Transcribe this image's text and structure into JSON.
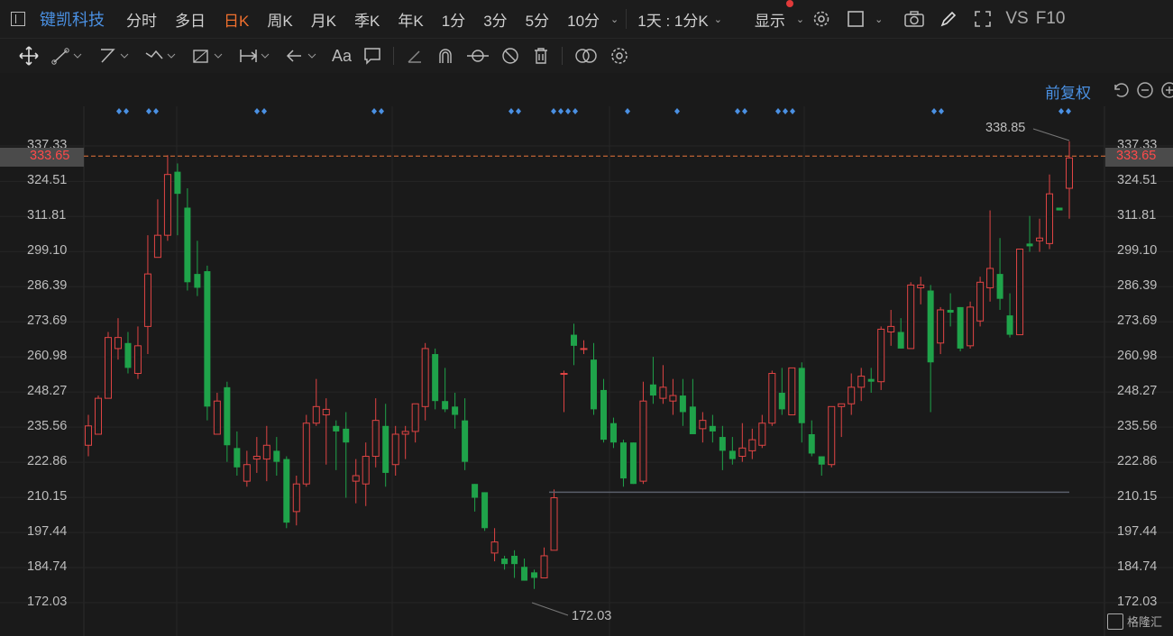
{
  "topbar": {
    "symbol": "键凯科技",
    "periods": [
      "分时",
      "多日",
      "日K",
      "周K",
      "月K",
      "季K",
      "年K",
      "1分",
      "3分",
      "5分",
      "10分"
    ],
    "active_period": "日K",
    "interval_select": "1天 : 1分K",
    "display_label": "显示",
    "vs_label": "VS",
    "f10_label": "F10"
  },
  "chart": {
    "adjust_label": "前复权",
    "current_price": "333.65",
    "high_label": "338.85",
    "low_label": "172.03",
    "y_ticks": [
      "337.33",
      "324.51",
      "311.81",
      "299.10",
      "286.39",
      "273.69",
      "260.98",
      "248.27",
      "235.56",
      "222.86",
      "210.15",
      "197.44",
      "184.74",
      "172.03"
    ],
    "watermark": "格隆汇",
    "up_color": "#e04444",
    "down_color": "#1fa34a",
    "marker_color": "#4a90e2",
    "ref_line_color": "#e8743b"
  },
  "chart_data": {
    "type": "candlestick",
    "ylim": [
      172.03,
      337.33
    ],
    "candles": [
      {
        "o": 229,
        "h": 240,
        "l": 225,
        "c": 236
      },
      {
        "o": 233,
        "h": 247,
        "l": 233,
        "c": 246
      },
      {
        "o": 246,
        "h": 270,
        "l": 246,
        "c": 268
      },
      {
        "o": 264,
        "h": 275,
        "l": 260,
        "c": 268
      },
      {
        "o": 266,
        "h": 270,
        "l": 255,
        "c": 257
      },
      {
        "o": 255,
        "h": 272,
        "l": 253,
        "c": 265
      },
      {
        "o": 272,
        "h": 305,
        "l": 262,
        "c": 291
      },
      {
        "o": 297,
        "h": 318,
        "l": 297,
        "c": 305
      },
      {
        "o": 305,
        "h": 334,
        "l": 303,
        "c": 327
      },
      {
        "o": 328,
        "h": 331,
        "l": 305,
        "c": 320
      },
      {
        "o": 315,
        "h": 322,
        "l": 285,
        "c": 288
      },
      {
        "o": 291,
        "h": 303,
        "l": 283,
        "c": 286
      },
      {
        "o": 292,
        "h": 294,
        "l": 238,
        "c": 243
      },
      {
        "o": 233,
        "h": 248,
        "l": 233,
        "c": 245
      },
      {
        "o": 250,
        "h": 252,
        "l": 223,
        "c": 229
      },
      {
        "o": 228,
        "h": 234,
        "l": 218,
        "c": 221
      },
      {
        "o": 216,
        "h": 227,
        "l": 214,
        "c": 222
      },
      {
        "o": 224,
        "h": 232,
        "l": 219,
        "c": 225
      },
      {
        "o": 224,
        "h": 236,
        "l": 216,
        "c": 229
      },
      {
        "o": 227,
        "h": 232,
        "l": 218,
        "c": 223
      },
      {
        "o": 224,
        "h": 225,
        "l": 199,
        "c": 201
      },
      {
        "o": 205,
        "h": 218,
        "l": 200,
        "c": 215
      },
      {
        "o": 215,
        "h": 240,
        "l": 214,
        "c": 237
      },
      {
        "o": 237,
        "h": 253,
        "l": 236,
        "c": 243
      },
      {
        "o": 240,
        "h": 246,
        "l": 222,
        "c": 242
      },
      {
        "o": 236,
        "h": 238,
        "l": 220,
        "c": 234
      },
      {
        "o": 235,
        "h": 241,
        "l": 210,
        "c": 230
      },
      {
        "o": 216,
        "h": 224,
        "l": 208,
        "c": 218
      },
      {
        "o": 215,
        "h": 230,
        "l": 207,
        "c": 225
      },
      {
        "o": 225,
        "h": 246,
        "l": 221,
        "c": 238
      },
      {
        "o": 236,
        "h": 244,
        "l": 214,
        "c": 219
      },
      {
        "o": 222,
        "h": 236,
        "l": 218,
        "c": 233
      },
      {
        "o": 233,
        "h": 236,
        "l": 224,
        "c": 234
      },
      {
        "o": 234,
        "h": 244,
        "l": 230,
        "c": 244
      },
      {
        "o": 243,
        "h": 266,
        "l": 238,
        "c": 264
      },
      {
        "o": 262,
        "h": 264,
        "l": 242,
        "c": 245
      },
      {
        "o": 245,
        "h": 257,
        "l": 241,
        "c": 242
      },
      {
        "o": 243,
        "h": 248,
        "l": 235,
        "c": 240
      },
      {
        "o": 238,
        "h": 246,
        "l": 220,
        "c": 223
      },
      {
        "o": 215,
        "h": 213,
        "l": 205,
        "c": 210
      },
      {
        "o": 212,
        "h": 211,
        "l": 198,
        "c": 199
      },
      {
        "o": 190,
        "h": 199,
        "l": 187,
        "c": 194
      },
      {
        "o": 188,
        "h": 189,
        "l": 184,
        "c": 186
      },
      {
        "o": 189,
        "h": 191,
        "l": 181,
        "c": 186
      },
      {
        "o": 185,
        "h": 188,
        "l": 180,
        "c": 180
      },
      {
        "o": 183,
        "h": 184,
        "l": 177,
        "c": 181
      },
      {
        "o": 181,
        "h": 192,
        "l": 181,
        "c": 189
      },
      {
        "o": 191,
        "h": 213,
        "l": 192,
        "c": 210
      },
      {
        "o": 255,
        "h": 256,
        "l": 241,
        "c": 255
      },
      {
        "o": 269,
        "h": 273,
        "l": 258,
        "c": 265
      },
      {
        "o": 264,
        "h": 267,
        "l": 262,
        "c": 264
      },
      {
        "o": 260,
        "h": 266,
        "l": 240,
        "c": 242
      },
      {
        "o": 249,
        "h": 253,
        "l": 230,
        "c": 231
      },
      {
        "o": 237,
        "h": 239,
        "l": 228,
        "c": 230
      },
      {
        "o": 230,
        "h": 231,
        "l": 214,
        "c": 217
      },
      {
        "o": 230,
        "h": 229,
        "l": 215,
        "c": 215
      },
      {
        "o": 216,
        "h": 252,
        "l": 215,
        "c": 245
      },
      {
        "o": 251,
        "h": 261,
        "l": 244,
        "c": 247
      },
      {
        "o": 246,
        "h": 258,
        "l": 244,
        "c": 250
      },
      {
        "o": 245,
        "h": 253,
        "l": 240,
        "c": 247
      },
      {
        "o": 247,
        "h": 253,
        "l": 236,
        "c": 241
      },
      {
        "o": 243,
        "h": 253,
        "l": 234,
        "c": 233
      },
      {
        "o": 235,
        "h": 241,
        "l": 230,
        "c": 238
      },
      {
        "o": 236,
        "h": 240,
        "l": 230,
        "c": 234
      },
      {
        "o": 232,
        "h": 236,
        "l": 220,
        "c": 227
      },
      {
        "o": 227,
        "h": 232,
        "l": 222,
        "c": 224
      },
      {
        "o": 225,
        "h": 237,
        "l": 223,
        "c": 228
      },
      {
        "o": 227,
        "h": 235,
        "l": 224,
        "c": 231
      },
      {
        "o": 229,
        "h": 240,
        "l": 228,
        "c": 237
      },
      {
        "o": 237,
        "h": 256,
        "l": 236,
        "c": 255
      },
      {
        "o": 248,
        "h": 257,
        "l": 240,
        "c": 242
      },
      {
        "o": 240,
        "h": 257,
        "l": 240,
        "c": 257
      },
      {
        "o": 257,
        "h": 259,
        "l": 230,
        "c": 237
      },
      {
        "o": 233,
        "h": 238,
        "l": 225,
        "c": 226
      },
      {
        "o": 225,
        "h": 224,
        "l": 218,
        "c": 222
      },
      {
        "o": 222,
        "h": 243,
        "l": 221,
        "c": 243
      },
      {
        "o": 243,
        "h": 244,
        "l": 232,
        "c": 244
      },
      {
        "o": 244,
        "h": 255,
        "l": 240,
        "c": 250
      },
      {
        "o": 250,
        "h": 257,
        "l": 245,
        "c": 254
      },
      {
        "o": 253,
        "h": 257,
        "l": 248,
        "c": 252
      },
      {
        "o": 252,
        "h": 272,
        "l": 249,
        "c": 271
      },
      {
        "o": 270,
        "h": 278,
        "l": 265,
        "c": 272
      },
      {
        "o": 270,
        "h": 275,
        "l": 264,
        "c": 264
      },
      {
        "o": 264,
        "h": 288,
        "l": 265,
        "c": 287
      },
      {
        "o": 286,
        "h": 290,
        "l": 280,
        "c": 287
      },
      {
        "o": 285,
        "h": 287,
        "l": 241,
        "c": 259
      },
      {
        "o": 266,
        "h": 279,
        "l": 262,
        "c": 278
      },
      {
        "o": 278,
        "h": 284,
        "l": 272,
        "c": 277
      },
      {
        "o": 279,
        "h": 279,
        "l": 263,
        "c": 264
      },
      {
        "o": 265,
        "h": 281,
        "l": 264,
        "c": 279
      },
      {
        "o": 274,
        "h": 290,
        "l": 272,
        "c": 288
      },
      {
        "o": 286,
        "h": 314,
        "l": 281,
        "c": 293
      },
      {
        "o": 291,
        "h": 304,
        "l": 278,
        "c": 282
      },
      {
        "o": 276,
        "h": 284,
        "l": 268,
        "c": 269
      },
      {
        "o": 269,
        "h": 300,
        "l": 269,
        "c": 300
      },
      {
        "o": 302,
        "h": 312,
        "l": 299,
        "c": 301
      },
      {
        "o": 303,
        "h": 311,
        "l": 299,
        "c": 304
      },
      {
        "o": 302,
        "h": 327,
        "l": 300,
        "c": 320
      },
      {
        "o": 315,
        "h": 315,
        "l": 314,
        "c": 314
      },
      {
        "o": 322,
        "h": 339,
        "l": 311,
        "c": 333
      }
    ],
    "marker_groups": [
      {
        "x": 136,
        "n": 2
      },
      {
        "x": 169,
        "n": 2
      },
      {
        "x": 289,
        "n": 2
      },
      {
        "x": 419,
        "n": 2
      },
      {
        "x": 571,
        "n": 2
      },
      {
        "x": 626,
        "n": 4
      },
      {
        "x": 696,
        "n": 1
      },
      {
        "x": 751,
        "n": 1
      },
      {
        "x": 822,
        "n": 2
      },
      {
        "x": 871,
        "n": 3
      },
      {
        "x": 1040,
        "n": 2
      },
      {
        "x": 1181,
        "n": 2
      }
    ],
    "support_line_value": 212.0
  }
}
